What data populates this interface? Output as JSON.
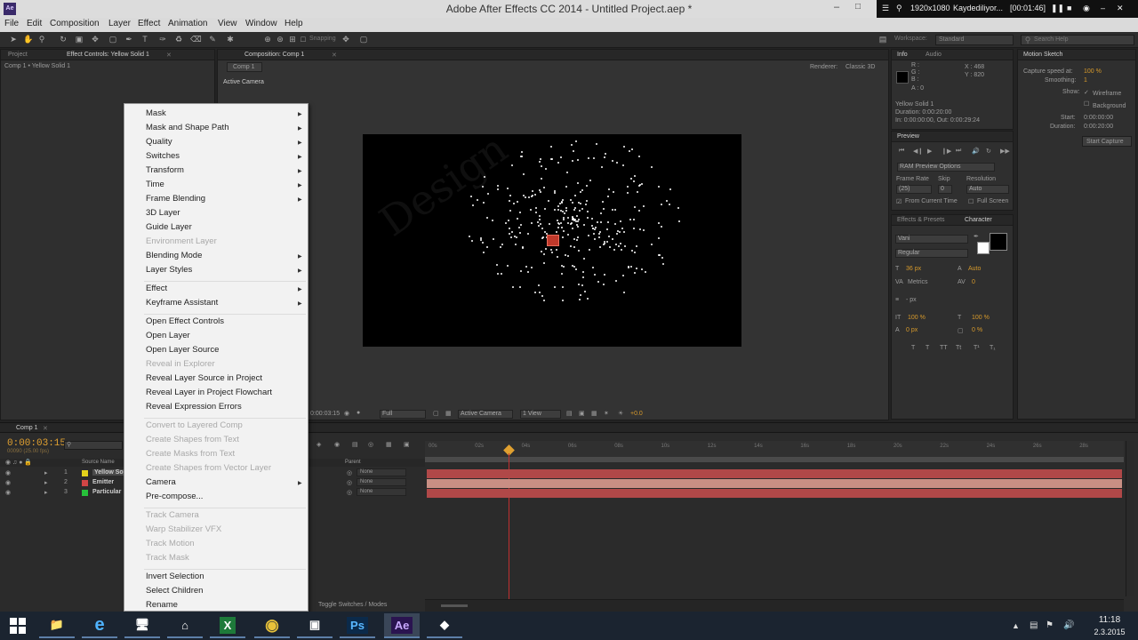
{
  "window": {
    "title": "Adobe After Effects CC 2014 - Untitled Project.aep *",
    "app_icon_label": "Ae"
  },
  "recorder": {
    "resolution": "1920x1080",
    "status": "Kaydediliyor...",
    "time": "[00:01:46]"
  },
  "menubar": [
    "File",
    "Edit",
    "Composition",
    "Layer",
    "Effect",
    "Animation",
    "View",
    "Window",
    "Help"
  ],
  "toolbar": {
    "snapping_label": "Snapping",
    "workspace_label": "Workspace:",
    "workspace_value": "Standard",
    "search_placeholder": "Search Help"
  },
  "project_panel": {
    "tabs": [
      "Project",
      "Effect Controls: Yellow Solid 1"
    ],
    "breadcrumb": "Comp 1 • Yellow Solid 1"
  },
  "comp_panel": {
    "tab_label": "Composition: Comp 1",
    "sub_tab": "Comp 1",
    "renderer_label": "Renderer:",
    "renderer_value": "Classic 3D",
    "view_label": "Active Camera",
    "footer": {
      "timecode": "0:00:03:15",
      "resolution": "Full",
      "camera": "Active Camera",
      "views": "1 View",
      "exposure": "+0.0"
    }
  },
  "info_panel": {
    "tabs": [
      "Info",
      "Audio"
    ],
    "rgba": [
      "R :",
      "G :",
      "B :",
      "A : 0"
    ],
    "x": "X : 468",
    "y": "Y : 820",
    "layer_name": "Yellow Solid 1",
    "duration": "Duration: 0:00:20:00",
    "in_out": "In: 0:00:00:00, Out: 0:00:29:24"
  },
  "preview_panel": {
    "tab": "Preview",
    "options": "RAM Preview Options",
    "frame_rate_label": "Frame Rate",
    "skip_label": "Skip",
    "resolution_label": "Resolution",
    "frame_rate_value": "(25)",
    "skip_value": "0",
    "resolution_value": "Auto",
    "from_current_time": "From Current Time",
    "full_screen": "Full Screen"
  },
  "character_panel": {
    "tabs": [
      "Effects & Presets",
      "Character"
    ],
    "font": "Vani",
    "style": "Regular",
    "size": "36 px",
    "leading": "Auto",
    "kerning": "Metrics",
    "tracking": "0",
    "stroke": "- px",
    "vscale": "100 %",
    "hscale": "100 %",
    "baseline": "0 px",
    "tsume": "0 %"
  },
  "motion_sketch": {
    "tab": "Motion Sketch",
    "capture_speed_label": "Capture speed at:",
    "capture_speed_value": "100 %",
    "smoothing_label": "Smoothing:",
    "smoothing_value": "1",
    "show_label": "Show:",
    "wireframe": "Wireframe",
    "background": "Background",
    "start_label": "Start:",
    "start_value": "0:00:00:00",
    "duration_label": "Duration:",
    "duration_value": "0:00:20:00",
    "button": "Start Capture"
  },
  "context_menu": {
    "items": [
      {
        "label": "Mask",
        "submenu": true,
        "disabled": false
      },
      {
        "label": "Mask and Shape Path",
        "submenu": true,
        "disabled": false
      },
      {
        "label": "Quality",
        "submenu": true,
        "disabled": false
      },
      {
        "label": "Switches",
        "submenu": true,
        "disabled": false
      },
      {
        "label": "Transform",
        "submenu": true,
        "disabled": false
      },
      {
        "label": "Time",
        "submenu": true,
        "disabled": false
      },
      {
        "label": "Frame Blending",
        "submenu": true,
        "disabled": false
      },
      {
        "label": "3D Layer",
        "submenu": false,
        "disabled": false
      },
      {
        "label": "Guide Layer",
        "submenu": false,
        "disabled": false
      },
      {
        "label": "Environment Layer",
        "submenu": false,
        "disabled": true
      },
      {
        "label": "Blending Mode",
        "submenu": true,
        "disabled": false
      },
      {
        "label": "Layer Styles",
        "submenu": true,
        "disabled": false
      },
      {
        "label": "Effect",
        "submenu": true,
        "disabled": false
      },
      {
        "label": "Keyframe Assistant",
        "submenu": true,
        "disabled": false
      },
      {
        "label": "Open Effect Controls",
        "submenu": false,
        "disabled": false
      },
      {
        "label": "Open Layer",
        "submenu": false,
        "disabled": false
      },
      {
        "label": "Open Layer Source",
        "submenu": false,
        "disabled": false
      },
      {
        "label": "Reveal in Explorer",
        "submenu": false,
        "disabled": true
      },
      {
        "label": "Reveal Layer Source in Project",
        "submenu": false,
        "disabled": false
      },
      {
        "label": "Reveal Layer in Project Flowchart",
        "submenu": false,
        "disabled": false
      },
      {
        "label": "Reveal Expression Errors",
        "submenu": false,
        "disabled": false
      },
      {
        "label": "Convert to Layered Comp",
        "submenu": false,
        "disabled": true
      },
      {
        "label": "Create Shapes from Text",
        "submenu": false,
        "disabled": true
      },
      {
        "label": "Create Masks from Text",
        "submenu": false,
        "disabled": true
      },
      {
        "label": "Create Shapes from Vector Layer",
        "submenu": false,
        "disabled": true
      },
      {
        "label": "Camera",
        "submenu": true,
        "disabled": false
      },
      {
        "label": "Pre-compose...",
        "submenu": false,
        "disabled": false
      },
      {
        "label": "Track Camera",
        "submenu": false,
        "disabled": true
      },
      {
        "label": "Warp Stabilizer VFX",
        "submenu": false,
        "disabled": true
      },
      {
        "label": "Track Motion",
        "submenu": false,
        "disabled": true
      },
      {
        "label": "Track Mask",
        "submenu": false,
        "disabled": true
      },
      {
        "label": "Invert Selection",
        "submenu": false,
        "disabled": false
      },
      {
        "label": "Select Children",
        "submenu": false,
        "disabled": false
      },
      {
        "label": "Rename",
        "submenu": false,
        "disabled": false
      }
    ]
  },
  "timeline": {
    "tab": "Comp 1",
    "timecode": "0:00:03:15",
    "frame_info": "00090 (25.00 fps)",
    "source_name_header": "Source Name",
    "parent_header": "Parent",
    "layers": [
      {
        "num": "1",
        "name": "Yellow So",
        "color": "#e3d21b",
        "parent": "None"
      },
      {
        "num": "2",
        "name": "Emitter",
        "color": "#d04545",
        "parent": "None"
      },
      {
        "num": "3",
        "name": "Particular",
        "color": "#27c13a",
        "parent": "None"
      }
    ],
    "ruler": [
      "00s",
      "02s",
      "04s",
      "06s",
      "08s",
      "10s",
      "12s",
      "14s",
      "16s",
      "18s",
      "20s",
      "22s",
      "24s",
      "26s",
      "28s",
      "30s"
    ],
    "toggle_label": "Toggle Switches / Modes"
  },
  "taskbar": {
    "apps": [
      {
        "name": "file-explorer",
        "label": "📁"
      },
      {
        "name": "internet-explorer",
        "label": "e"
      },
      {
        "name": "computer",
        "label": "🖥"
      },
      {
        "name": "home",
        "label": "⌂"
      },
      {
        "name": "excel",
        "label": "X"
      },
      {
        "name": "chrome",
        "label": "◉"
      },
      {
        "name": "media",
        "label": "▣"
      },
      {
        "name": "photoshop",
        "label": "Ps"
      },
      {
        "name": "after-effects",
        "label": "Ae"
      },
      {
        "name": "box-app",
        "label": "◆"
      }
    ],
    "time": "11:18",
    "date": "2.3.2015"
  },
  "colors": {
    "accent_orange": "#d79a2b",
    "menu_bg": "#f2f2f2",
    "layer_bar_red": "#b04848",
    "layer_bar_pink": "#c98f84"
  }
}
